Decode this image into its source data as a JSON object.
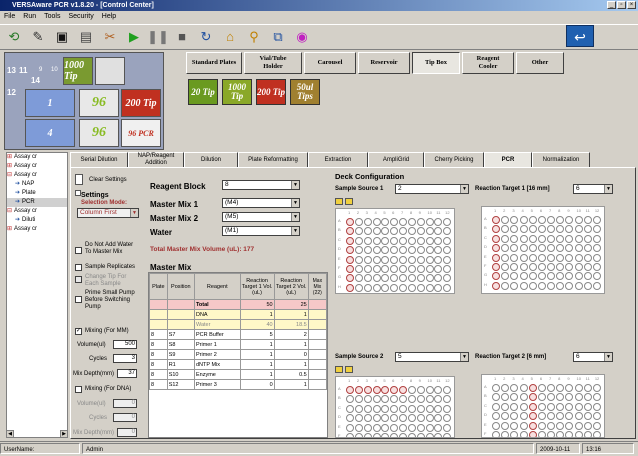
{
  "window": {
    "title": "VERSAware PCR v1.8.20 - [Control Center]"
  },
  "menu": [
    "File",
    "Run",
    "Tools",
    "Security",
    "Help"
  ],
  "toolbar_icons": [
    "new-icon",
    "edit-icon",
    "print-icon",
    "report-icon",
    "tools-icon",
    "play-icon",
    "pause-icon",
    "stop-icon",
    "refresh-icon",
    "home-icon",
    "search-icon",
    "connect-icon",
    "color-wheel-icon"
  ],
  "deck_thumb": {
    "labels": {
      "n13": "13",
      "n11": "11",
      "n9": "9",
      "n10": "10",
      "n14": "14",
      "n12": "12",
      "n1": "1",
      "n4": "4"
    },
    "tips": [
      "1000 Tip",
      "96",
      "96",
      "200 Tip",
      "96 PCR"
    ]
  },
  "carousel": {
    "tabs": [
      "Standard Plates",
      "Vial/Tube Holder",
      "Carousel",
      "Reservoir",
      "Tip Box",
      "Reagent Cooler",
      "Other"
    ],
    "active": "Tip Box",
    "tips": [
      "20 Tip",
      "1000 Tip",
      "200 Tip",
      "50ul Tips"
    ]
  },
  "tree": [
    "Assay cr",
    "Assay cr",
    "Assay cr",
    "NAP",
    "Plate",
    "PCR",
    "Diluti",
    "Assay cr",
    "Assay cr"
  ],
  "tabs": [
    "Serial Dilution",
    "NAP/Reagent Addition",
    "Dilution",
    "Plate Reformatting",
    "Extraction",
    "AmpliGrid",
    "Cherry Picking",
    "PCR",
    "Normalization"
  ],
  "active_tab": "PCR",
  "left_panel": {
    "clear_settings": "Clear Settings",
    "settings": "Settings",
    "selection_mode_label": "Selection Mode:",
    "selection_mode_value": "Column First",
    "do_not_add": "Do Not Add Water To Master Mix",
    "sample_replicates": "Sample Replicates",
    "change_tip": "Change Tip For Each Sample",
    "prime_pump": "Prime Small Pump Before Switching Pump",
    "mixing_mm": "Mixing (For MM)",
    "volume_label": "Volume(ul)",
    "volume_value": "500",
    "cycles_label": "Cycles",
    "cycles_value": "3",
    "mix_depth_label": "Mix Depth(mm)",
    "mix_depth_value": "37",
    "mixing_dna": "Mixing (For DNA)",
    "volume2_label": "Volume(ul)",
    "volume2_value": "0",
    "cycles2_label": "Cycles",
    "cycles2_value": "0",
    "mix_depth2_label": "Mix Depth(mm)",
    "mix_depth2_value": "0"
  },
  "reagents": {
    "reagent_block_label": "Reagent Block",
    "reagent_block_value": "8",
    "mm1_label": "Master Mix 1",
    "mm1_value": "(M4)",
    "mm2_label": "Master Mix 2",
    "mm2_value": "(M5)",
    "water_label": "Water",
    "water_value": "(M1)",
    "total_label": "Total Master Mix Volume (uL): 177"
  },
  "master_mix": {
    "title": "Master Mix",
    "headers": [
      "Plate",
      "Position",
      "Reagent",
      "Reaction Target 1 Vol. (uL)",
      "Reaction Target 2 Vol. (uL)",
      "Max Mix (22)"
    ],
    "rows": [
      {
        "plate": "",
        "pos": "",
        "reagent": "Total",
        "t1": "50",
        "t2": "25"
      },
      {
        "plate": "",
        "pos": "",
        "reagent": "DNA",
        "t1": "1",
        "t2": "1"
      },
      {
        "plate": "",
        "pos": "",
        "reagent": "Water",
        "t1": "40",
        "t2": "18.5"
      },
      {
        "plate": "8",
        "pos": "S7",
        "reagent": "PCR Buffer",
        "t1": "5",
        "t2": "2"
      },
      {
        "plate": "8",
        "pos": "S8",
        "reagent": "Primer 1",
        "t1": "1",
        "t2": "1"
      },
      {
        "plate": "8",
        "pos": "S9",
        "reagent": "Primer 2",
        "t1": "1",
        "t2": "0"
      },
      {
        "plate": "8",
        "pos": "R1",
        "reagent": "dNTP Mix",
        "t1": "1",
        "t2": "1"
      },
      {
        "plate": "8",
        "pos": "S10",
        "reagent": "Enzyme",
        "t1": "1",
        "t2": "0.5"
      },
      {
        "plate": "8",
        "pos": "S12",
        "reagent": "Primer 3",
        "t1": "0",
        "t2": "1"
      }
    ]
  },
  "deck": {
    "title": "Deck Configuration",
    "src1_label": "Sample Source 1",
    "src1_value": "2",
    "tgt1_label": "Reaction Target 1 [16 mm]",
    "tgt1_value": "6",
    "src2_label": "Sample Source 2",
    "src2_value": "5",
    "tgt2_label": "Reaction Target 2 [6 mm]",
    "tgt2_value": "6",
    "rows": [
      "A",
      "B",
      "C",
      "D",
      "E",
      "F",
      "G",
      "H"
    ],
    "cols": [
      "1",
      "2",
      "3",
      "4",
      "5",
      "6",
      "7",
      "8",
      "9",
      "10",
      "11",
      "12"
    ]
  },
  "status": {
    "user_label": "UserName:",
    "user": "Admin",
    "date": "2009-10-11",
    "time": "13:16"
  }
}
